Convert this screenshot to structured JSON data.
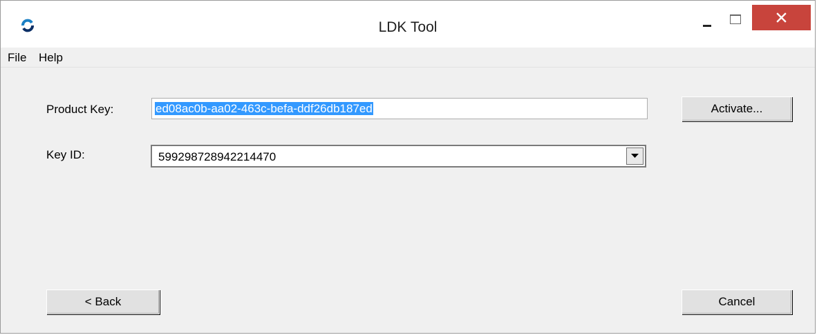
{
  "window": {
    "title": "LDK Tool",
    "icon": "ldk-app-icon",
    "close_color": "#c8443c"
  },
  "menu": {
    "items": [
      "File",
      "Help"
    ]
  },
  "form": {
    "product_key_label": "Product Key:",
    "product_key_value": "ed08ac0b-aa02-463c-befa-ddf26db187ed",
    "key_id_label": "Key ID:",
    "key_id_value": "599298728942214470",
    "selection_color": "#3399ff"
  },
  "buttons": {
    "activate": "Activate...",
    "back": "< Back",
    "cancel": "Cancel"
  }
}
